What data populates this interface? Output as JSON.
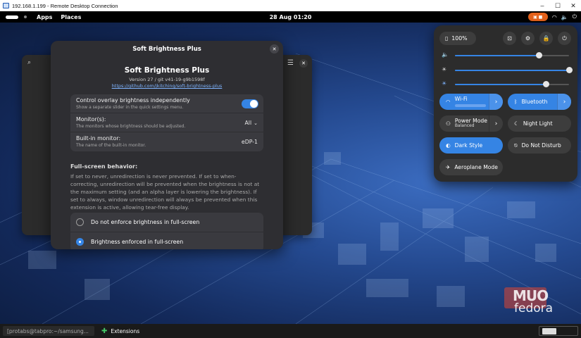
{
  "window_title": "192.168.1.199 - Remote Desktop Connection",
  "window_controls": {
    "minimize": "–",
    "maximize": "☐",
    "close": "✕"
  },
  "topbar": {
    "apps": "Apps",
    "places": "Places",
    "clock": "28 Aug  01:20",
    "tray_icons": [
      "screen-recorder-icon",
      "wifi-icon",
      "volume-icon",
      "power-icon"
    ]
  },
  "dialog": {
    "header_title": "Soft Brightness Plus",
    "close": "✕",
    "ext_title": "Soft Brightness Plus",
    "ext_version": "Version 27 / git v41-19-g9b1598f",
    "ext_url": "https://github.com/jkitching/soft-brightness-plus",
    "rows": [
      {
        "label": "Control overlay brightness independently",
        "sub": "Show a separate slider in the quick settings menu.",
        "toggle_on": true
      },
      {
        "label": "Monitor(s):",
        "sub": "The monitors whose brightness should be adjusted.",
        "value": "All"
      },
      {
        "label": "Built-in monitor:",
        "sub": "The name of the built-in monitor.",
        "value": "eDP-1"
      }
    ],
    "fullscreen_title": "Full-screen behavior:",
    "fullscreen_desc": "If set to never, unredirection is never prevented. If set to when-correcting, unredirection will be prevented when the brightness is not at the maximum setting (and an alpha layer is lowering the brightness). If set to always, window unredirection will always be prevented when this extension is active, allowing tear-free display.",
    "radio_options": [
      {
        "label": "Do not enforce brightness in full-screen",
        "selected": false
      },
      {
        "label": "Brightness enforced in full-screen",
        "selected": true
      }
    ]
  },
  "quick_settings": {
    "battery": "100%",
    "sliders": [
      {
        "name": "volume",
        "icon": "🔈",
        "value": 0.74
      },
      {
        "name": "brightness",
        "icon": "☀",
        "value": 1.0
      },
      {
        "name": "overlay-brightness",
        "icon": "☀",
        "value": 0.8
      }
    ],
    "tiles": [
      {
        "id": "wifi",
        "label": "Wi-Fi",
        "on": true,
        "arrow": true,
        "icon": "wifi"
      },
      {
        "id": "bluetooth",
        "label": "Bluetooth",
        "on": true,
        "arrow": true,
        "icon": "bluetooth"
      },
      {
        "id": "power-mode",
        "label": "Power Mode",
        "sub": "Balanced",
        "on": false,
        "arrow": true,
        "icon": "power-mode"
      },
      {
        "id": "night-light",
        "label": "Night Light",
        "on": false,
        "arrow": false,
        "icon": "night-light"
      },
      {
        "id": "dark-style",
        "label": "Dark Style",
        "on": true,
        "arrow": false,
        "icon": "dark-style"
      },
      {
        "id": "do-not-disturb",
        "label": "Do Not Disturb",
        "on": false,
        "arrow": false,
        "icon": "bell-off"
      },
      {
        "id": "aeroplane",
        "label": "Aeroplane Mode",
        "on": false,
        "arrow": false,
        "icon": "airplane"
      }
    ]
  },
  "taskbar": {
    "task1": "[protabs@tabpro:~/samsung...",
    "task2": "Extensions"
  },
  "watermark": {
    "muo": "MUO",
    "fedora": "fedora"
  },
  "colors": {
    "accent": "#3584e4",
    "panel": "#2c2c2c",
    "dialog": "#2e2e32"
  }
}
